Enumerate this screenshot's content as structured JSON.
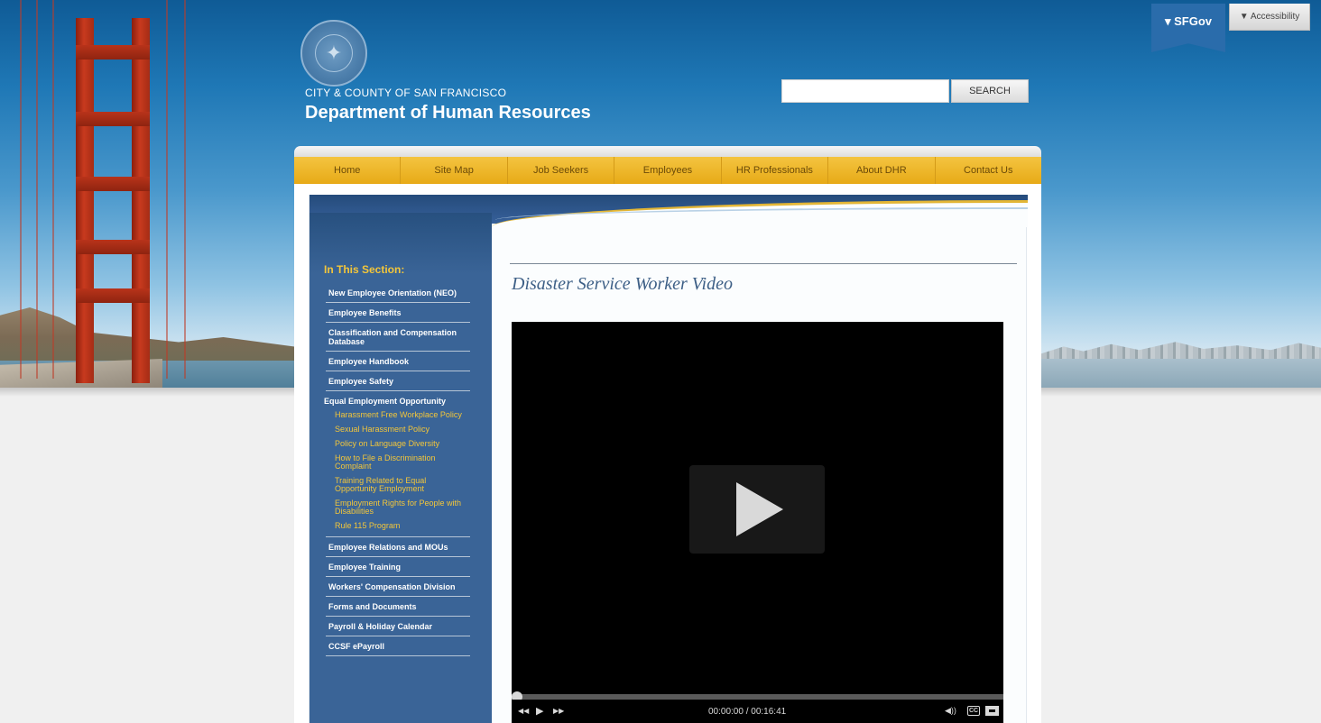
{
  "header": {
    "city_county": "CITY & COUNTY OF SAN FRANCISCO",
    "dept_title": "Department of Human Resources",
    "search_placeholder": "",
    "search_button": "SEARCH",
    "sfgov_tab": "▾ SFGov",
    "accessibility_tab": "▼ Accessibility"
  },
  "nav": {
    "items": [
      "Home",
      "Site Map",
      "Job Seekers",
      "Employees",
      "HR Professionals",
      "About DHR",
      "Contact Us"
    ]
  },
  "sidebar": {
    "heading": "In This Section:",
    "items_top": [
      "New Employee Orientation (NEO)",
      "Employee Benefits",
      "Classification and Compensation Database",
      "Employee Handbook",
      "Employee Safety"
    ],
    "expanded_item": "Equal Employment Opportunity",
    "sub_items": [
      "Harassment Free Workplace Policy",
      "Sexual Harassment Policy",
      "Policy on Language Diversity",
      "How to File a Discrimination Complaint",
      "Training Related to Equal Opportunity Employment",
      "Employment Rights for People with Disabilities",
      "Rule 115 Program"
    ],
    "items_bottom": [
      "Employee Relations and MOUs",
      "Employee Training",
      "Workers' Compensation Division",
      "Forms and Documents",
      "Payroll & Holiday Calendar",
      "CCSF ePayroll"
    ]
  },
  "main": {
    "page_title": "Disaster Service Worker Video"
  },
  "player": {
    "time": "00:00:00 / 00:16:41",
    "cc_label": "CC",
    "progress_fraction": 0.0,
    "rewind_glyph": "◀◀",
    "play_glyph": "▶",
    "forward_glyph": "▶▶",
    "volume_glyph": "◀))"
  },
  "colors": {
    "nav_gold": "#e7aa17",
    "sidebar_blue": "#3a6497",
    "sub_link_gold": "#f3c63a",
    "title_blue": "#3d5f86"
  }
}
